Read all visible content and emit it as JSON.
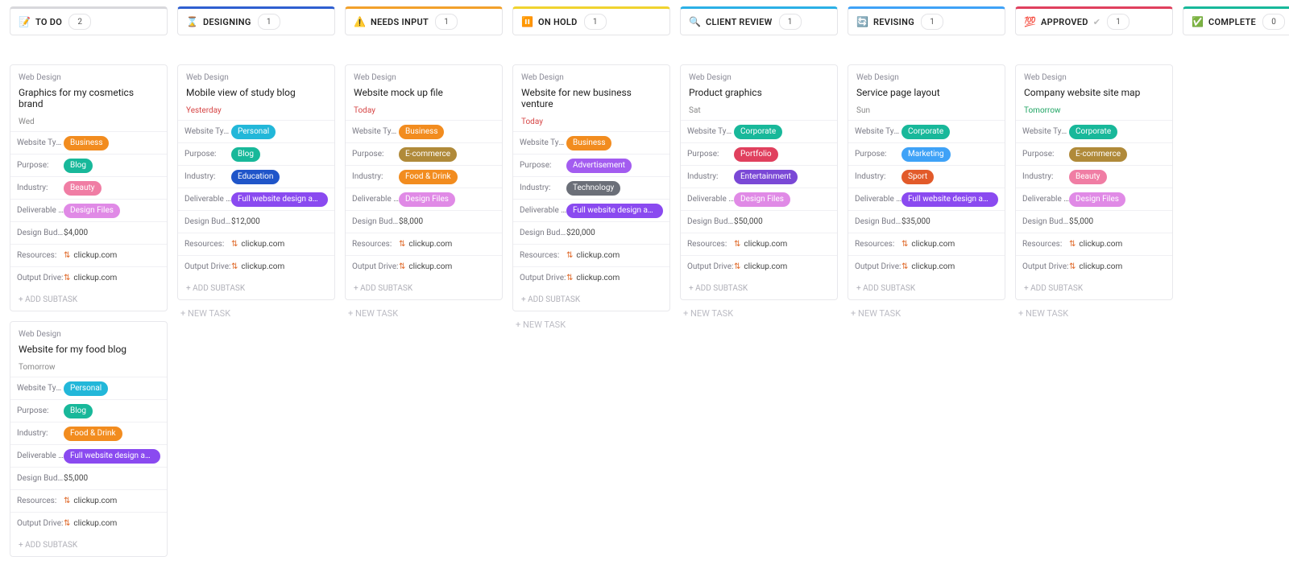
{
  "labels": {
    "websiteType": "Website Type:",
    "purpose": "Purpose:",
    "industry": "Industry:",
    "deliverable": "Deliverable ...",
    "designBudget": "Design Budg...",
    "resources": "Resources:",
    "outputDrive": "Output Drive:",
    "addSubtask": "+ ADD SUBTASK",
    "newTask": "+ NEW TASK"
  },
  "pillColors": {
    "Business": "#f28c1f",
    "Personal": "#22b7d9",
    "Corporate": "#18b89a",
    "Blog": "#18b89a",
    "Advertisement": "#a35cf0",
    "Portfolio": "#e0405e",
    "Marketing": "#3fa2f7",
    "E-commerce": "#b08a3a",
    "Beauty": "#f07da4",
    "Education": "#1f55c9",
    "Food & Drink": "#f28c1f",
    "Technology": "#6b6f78",
    "Entertainment": "#7a48d6",
    "Sport": "#e25a2a",
    "Design Files": "#e08ae6",
    "Full website design and lay...": "#8a4af0"
  },
  "columns": [
    {
      "name": "TO DO",
      "icon": "📝",
      "accent": "#d8d8dc",
      "count": "2",
      "cards": [
        {
          "project": "Web Design",
          "title": "Graphics for my cosmetics brand",
          "date": "Wed",
          "dateColor": "gray",
          "websiteType": "Business",
          "purpose": "Blog",
          "industry": "Beauty",
          "deliverable": "Design Files",
          "budget": "$4,000",
          "resources": "clickup.com",
          "output": "clickup.com"
        },
        {
          "project": "Web Design",
          "title": "Website for my food blog",
          "date": "Tomorrow",
          "dateColor": "gray",
          "websiteType": "Personal",
          "purpose": "Blog",
          "industry": "Food & Drink",
          "deliverable": "Full website design and lay...",
          "budget": "$5,000",
          "resources": "clickup.com",
          "output": "clickup.com"
        }
      ]
    },
    {
      "name": "DESIGNING",
      "icon": "⌛",
      "accent": "#2f5fd0",
      "count": "1",
      "cards": [
        {
          "project": "Web Design",
          "title": "Mobile view of study blog",
          "date": "Yesterday",
          "dateColor": "red",
          "websiteType": "Personal",
          "purpose": "Blog",
          "industry": "Education",
          "deliverable": "Full website design and lay...",
          "budget": "$12,000",
          "resources": "clickup.com",
          "output": "clickup.com"
        }
      ]
    },
    {
      "name": "NEEDS INPUT",
      "icon": "⚠️",
      "accent": "#f2a12b",
      "count": "1",
      "cards": [
        {
          "project": "Web Design",
          "title": "Website mock up file",
          "date": "Today",
          "dateColor": "red",
          "websiteType": "Business",
          "purpose": "E-commerce",
          "industry": "Food & Drink",
          "deliverable": "Design Files",
          "budget": "$8,000",
          "resources": "clickup.com",
          "output": "clickup.com"
        }
      ]
    },
    {
      "name": "ON HOLD",
      "icon": "⏸️",
      "accent": "#f0d32f",
      "count": "1",
      "cards": [
        {
          "project": "Web Design",
          "title": "Website for new business venture",
          "date": "Today",
          "dateColor": "red",
          "websiteType": "Business",
          "purpose": "Advertisement",
          "industry": "Technology",
          "deliverable": "Full website design and lay...",
          "budget": "$20,000",
          "resources": "clickup.com",
          "output": "clickup.com"
        }
      ]
    },
    {
      "name": "CLIENT REVIEW",
      "icon": "🔍",
      "accent": "#2bb0e6",
      "count": "1",
      "cards": [
        {
          "project": "Web Design",
          "title": "Product graphics",
          "date": "Sat",
          "dateColor": "gray",
          "websiteType": "Corporate",
          "purpose": "Portfolio",
          "industry": "Entertainment",
          "deliverable": "Design Files",
          "budget": "$50,000",
          "resources": "clickup.com",
          "output": "clickup.com"
        }
      ]
    },
    {
      "name": "REVISING",
      "icon": "🔄",
      "accent": "#3fa2f7",
      "count": "1",
      "cards": [
        {
          "project": "Web Design",
          "title": "Service page layout",
          "date": "Sun",
          "dateColor": "gray",
          "websiteType": "Corporate",
          "purpose": "Marketing",
          "industry": "Sport",
          "deliverable": "Full website design and lay...",
          "budget": "$35,000",
          "resources": "clickup.com",
          "output": "clickup.com"
        }
      ]
    },
    {
      "name": "APPROVED",
      "icon": "💯",
      "accent": "#e0405e",
      "count": "1",
      "approvedCheck": true,
      "cards": [
        {
          "project": "Web Design",
          "title": "Company website site map",
          "date": "Tomorrow",
          "dateColor": "green",
          "websiteType": "Corporate",
          "purpose": "E-commerce",
          "industry": "Beauty",
          "deliverable": "Design Files",
          "budget": "$5,000",
          "resources": "clickup.com",
          "output": "clickup.com"
        }
      ]
    },
    {
      "name": "COMPLETE",
      "icon": "✅",
      "accent": "#18b89a",
      "count": "0",
      "cards": []
    }
  ]
}
